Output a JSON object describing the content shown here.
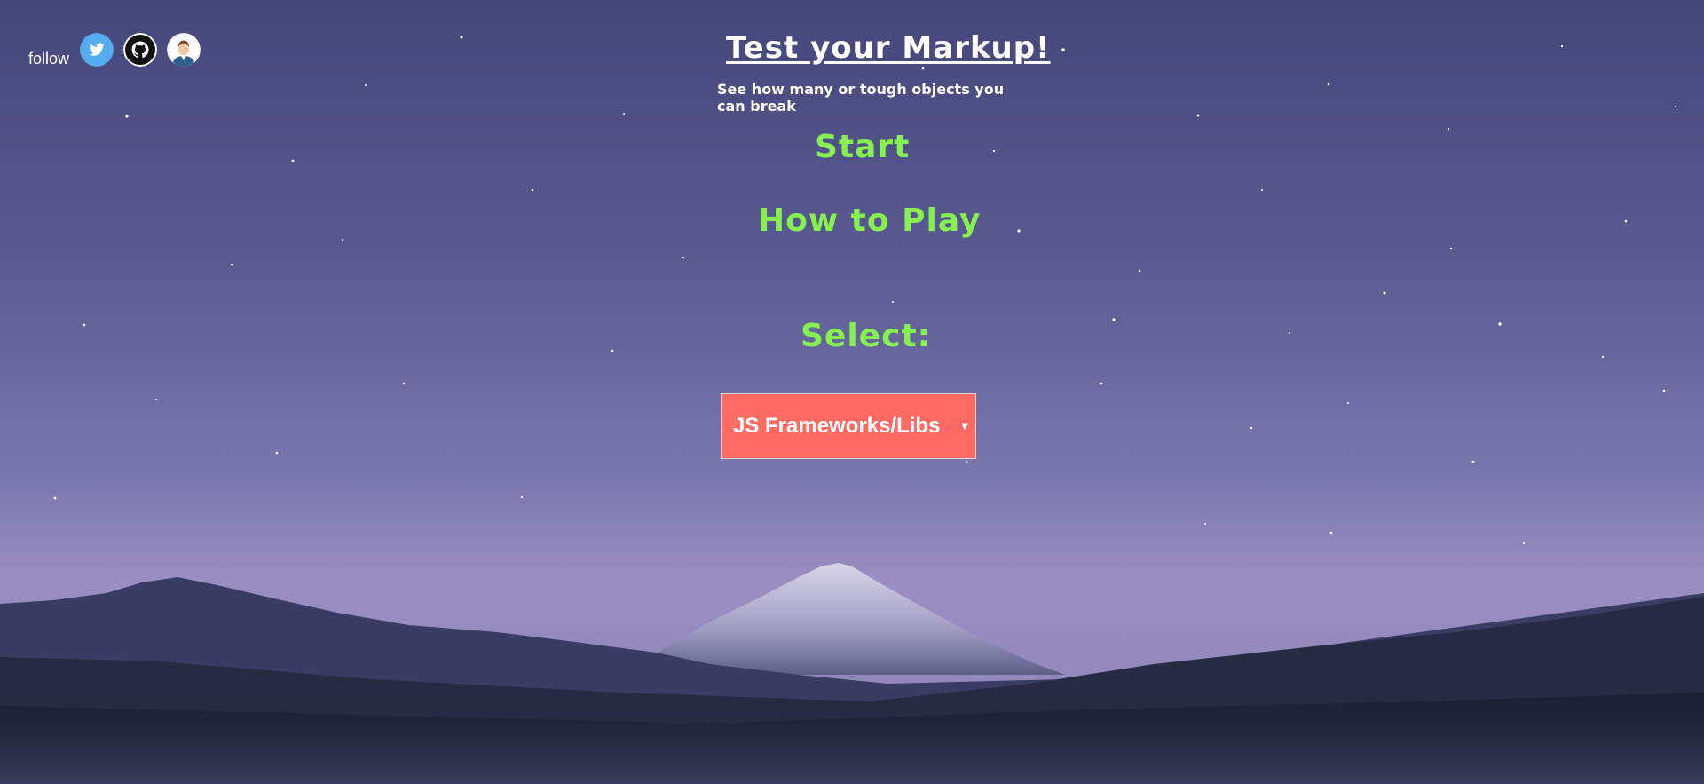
{
  "follow": {
    "label": "follow",
    "icons": [
      "twitter-icon",
      "github-icon",
      "avatar"
    ]
  },
  "header": {
    "title": "Test your Markup!",
    "subtitle": "See how many or tough objects you can break"
  },
  "menu": {
    "start": "Start",
    "how_to_play": "How to Play"
  },
  "select": {
    "label": "Select:",
    "value": "JS Frameworks/Libs"
  },
  "colors": {
    "accent_green": "#86f050",
    "dropdown_bg": "#ff6b63",
    "twitter_blue": "#55acee"
  }
}
